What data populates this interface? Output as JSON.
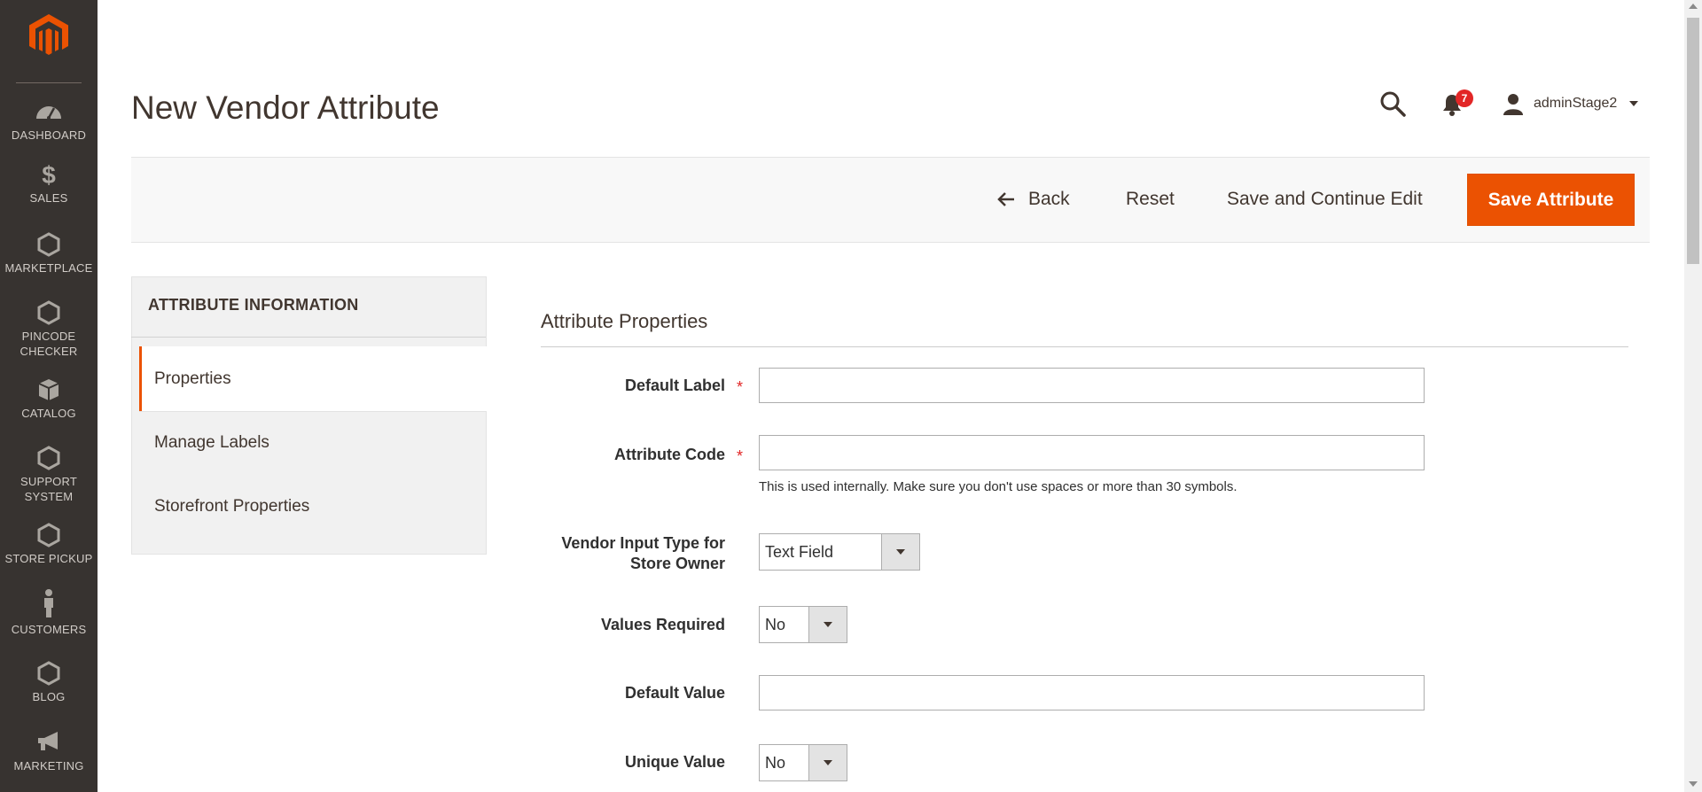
{
  "page": {
    "title": "New Vendor Attribute"
  },
  "header": {
    "notifications_count": "7",
    "user_name": "adminStage2",
    "icons": [
      "search-icon",
      "bell-icon",
      "user-icon",
      "chevron-down-icon"
    ]
  },
  "sidebar": {
    "items": [
      {
        "label": "DASHBOARD",
        "icon": "dashboard-icon"
      },
      {
        "label": "SALES",
        "icon": "dollar-icon"
      },
      {
        "label": "MARKETPLACE",
        "icon": "hexagon-icon"
      },
      {
        "label_line1": "PINCODE",
        "label_line2": "CHECKER",
        "icon": "hexagon-icon"
      },
      {
        "label": "CATALOG",
        "icon": "box-icon"
      },
      {
        "label_line1": "SUPPORT",
        "label_line2": "SYSTEM",
        "icon": "hexagon-icon"
      },
      {
        "label": "STORE PICKUP",
        "icon": "hexagon-icon"
      },
      {
        "label": "CUSTOMERS",
        "icon": "person-icon"
      },
      {
        "label": "BLOG",
        "icon": "hexagon-icon"
      },
      {
        "label": "MARKETING",
        "icon": "megaphone-icon"
      }
    ]
  },
  "actions": {
    "back": "Back",
    "reset": "Reset",
    "save_continue": "Save and Continue Edit",
    "save": "Save Attribute",
    "accent_color": "#eb5202"
  },
  "tabs": {
    "title": "ATTRIBUTE INFORMATION",
    "items": [
      {
        "label": "Properties",
        "active": true
      },
      {
        "label": "Manage Labels",
        "active": false
      },
      {
        "label": "Storefront Properties",
        "active": false
      }
    ]
  },
  "form": {
    "section_title": "Attribute Properties",
    "default_label": {
      "label": "Default Label",
      "value": ""
    },
    "attribute_code": {
      "label": "Attribute Code",
      "value": "",
      "note": "This is used internally. Make sure you don't use spaces or more than 30 symbols."
    },
    "input_type": {
      "label_line1": "Vendor Input Type for",
      "label_line2": "Store Owner",
      "value": "Text Field"
    },
    "values_required": {
      "label": "Values Required",
      "value": "No"
    },
    "default_value": {
      "label": "Default Value",
      "value": ""
    },
    "unique_value": {
      "label": "Unique Value",
      "value": "No"
    },
    "required_marker": "*"
  }
}
